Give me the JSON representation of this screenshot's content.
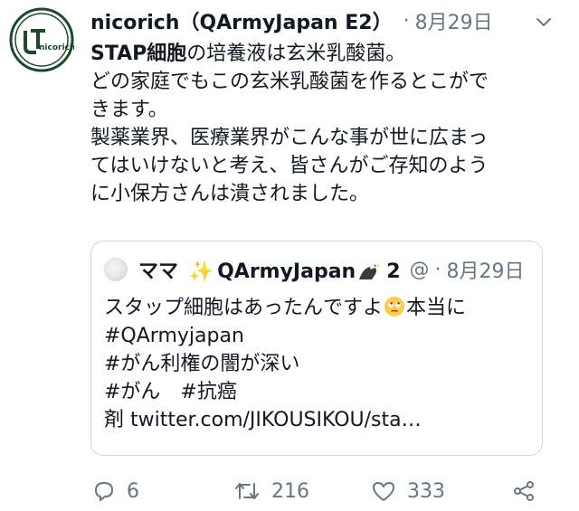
{
  "avatar": {
    "label": "nicorich",
    "brand_color": "#1b4a2b"
  },
  "tweet": {
    "author": "nicorich（QArmyJapan E2）",
    "separator": "·",
    "date": "8月29日",
    "lines": [
      "STAP細胞の培養液は玄米乳酸菌。",
      "どの家庭でもこの玄米乳酸菌を作るとこがで",
      "きます。",
      "製薬業界、医療業界がこんな事が世に広まっ",
      "てはいけないと考え、皆さんがご存知のよう",
      "に小保方さんは潰されました。"
    ],
    "bold_prefix": "STAP細胞"
  },
  "quoted": {
    "name_prefix": "ママ",
    "sparkles": "✨",
    "name_suffix": "QArmyJapan",
    "name_number": "2",
    "handle": "@",
    "separator": "·",
    "date": "8月29日",
    "line1_before": "スタップ細胞はあったんですよ",
    "line1_after": "本当に",
    "line2": "#QArmyjapan",
    "line3": "#がん利権の闇が深い",
    "line4": "#がん　#抗癌",
    "line5": "剤 twitter.com/JIKOUSIKOU/sta…"
  },
  "actions": {
    "reply_count": "6",
    "retweet_count": "216",
    "like_count": "333"
  },
  "colors": {
    "text": "#141823",
    "muted": "#657786",
    "border": "#ccd6dd"
  }
}
